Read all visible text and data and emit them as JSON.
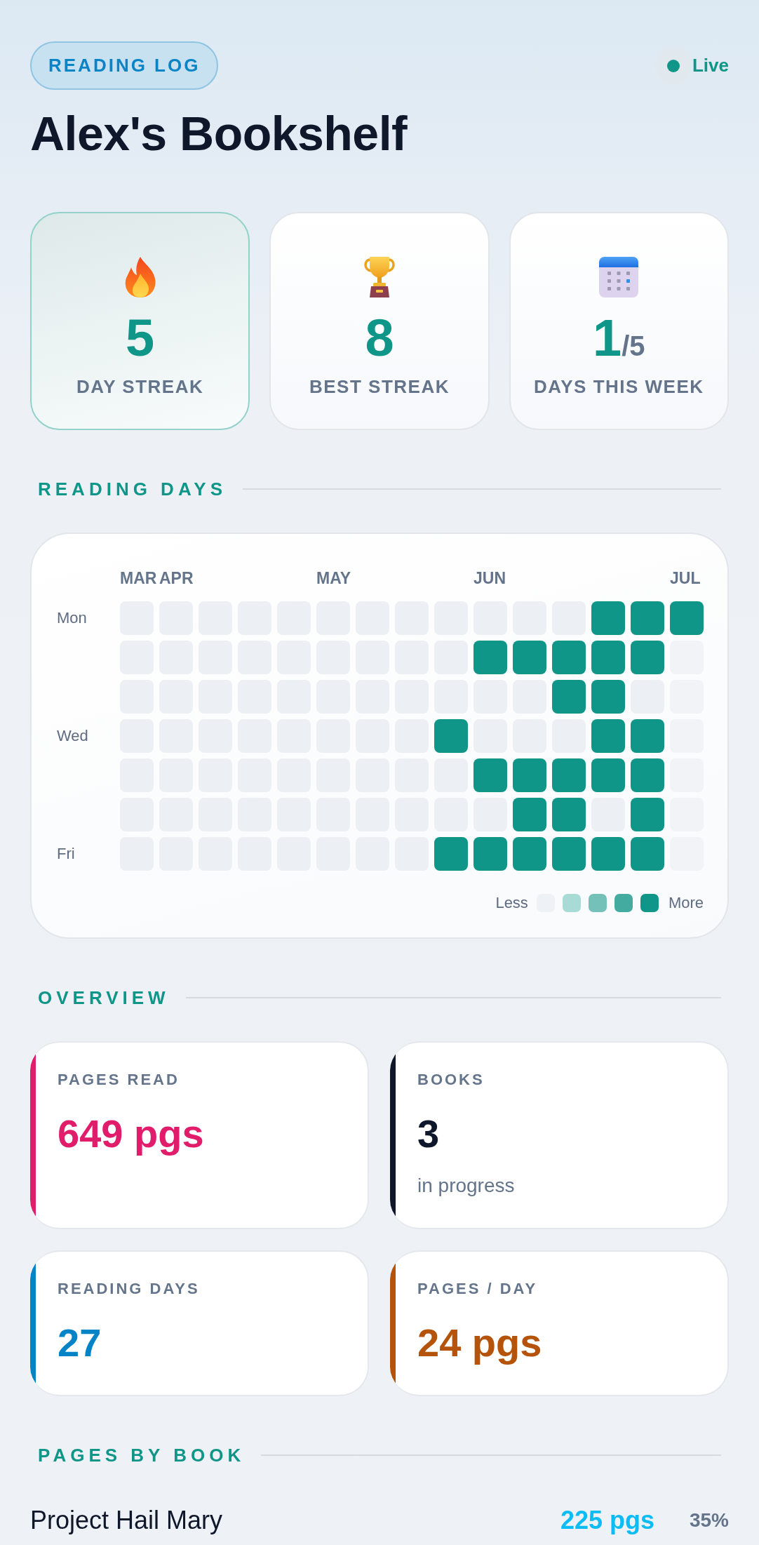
{
  "header": {
    "badge": "READING LOG",
    "status": {
      "label": "Live",
      "live": true
    },
    "title": "Alex's Bookshelf"
  },
  "stats": [
    {
      "kind": "streak",
      "value": "5",
      "label": "DAY STREAK",
      "highlighted": true
    },
    {
      "kind": "record",
      "value": "8",
      "label": "BEST STREAK",
      "highlighted": false
    },
    {
      "kind": "calendar",
      "value": "1",
      "suffix": "/5",
      "label": "DAYS THIS WEEK",
      "highlighted": false
    }
  ],
  "reading_days": {
    "heading": "READING DAYS",
    "weeks": [
      {
        "month": "MAR",
        "days": [
          {
            "kind": "empty",
            "weekday": "Mon"
          },
          {
            "kind": "empty"
          },
          {
            "kind": "empty"
          },
          {
            "kind": "empty",
            "weekday": "Wed"
          },
          {
            "kind": "empty"
          },
          {
            "kind": "empty"
          },
          {
            "kind": "empty",
            "weekday": "Fri"
          }
        ]
      },
      {
        "month": "APR",
        "days": [
          {
            "kind": "empty"
          },
          {
            "kind": "empty"
          },
          {
            "kind": "empty"
          },
          {
            "kind": "empty"
          },
          {
            "kind": "empty"
          },
          {
            "kind": "empty"
          },
          {
            "kind": "empty"
          }
        ]
      },
      {
        "days": [
          {
            "kind": "empty"
          },
          {
            "kind": "empty"
          },
          {
            "kind": "empty"
          },
          {
            "kind": "empty"
          },
          {
            "kind": "empty"
          },
          {
            "kind": "empty"
          },
          {
            "kind": "empty"
          }
        ]
      },
      {
        "days": [
          {
            "kind": "empty"
          },
          {
            "kind": "empty"
          },
          {
            "kind": "empty"
          },
          {
            "kind": "empty"
          },
          {
            "kind": "empty"
          },
          {
            "kind": "empty"
          },
          {
            "kind": "empty"
          }
        ]
      },
      {
        "days": [
          {
            "kind": "empty"
          },
          {
            "kind": "empty"
          },
          {
            "kind": "empty"
          },
          {
            "kind": "empty"
          },
          {
            "kind": "empty"
          },
          {
            "kind": "empty"
          },
          {
            "kind": "empty"
          }
        ]
      },
      {
        "month": "MAY",
        "days": [
          {
            "kind": "empty"
          },
          {
            "kind": "empty"
          },
          {
            "kind": "empty"
          },
          {
            "kind": "empty"
          },
          {
            "kind": "empty"
          },
          {
            "kind": "empty"
          },
          {
            "kind": "empty"
          }
        ]
      },
      {
        "days": [
          {
            "kind": "empty"
          },
          {
            "kind": "empty"
          },
          {
            "kind": "empty"
          },
          {
            "kind": "empty"
          },
          {
            "kind": "empty"
          },
          {
            "kind": "empty"
          },
          {
            "kind": "empty"
          }
        ]
      },
      {
        "days": [
          {
            "kind": "empty"
          },
          {
            "kind": "empty"
          },
          {
            "kind": "empty"
          },
          {
            "kind": "empty"
          },
          {
            "kind": "empty"
          },
          {
            "kind": "empty"
          },
          {
            "kind": "empty"
          }
        ]
      },
      {
        "days": [
          {
            "kind": "empty"
          },
          {
            "kind": "empty"
          },
          {
            "kind": "empty"
          },
          {
            "kind": "read"
          },
          {
            "kind": "empty"
          },
          {
            "kind": "empty"
          },
          {
            "kind": "read"
          }
        ]
      },
      {
        "month": "JUN",
        "days": [
          {
            "kind": "empty"
          },
          {
            "kind": "read"
          },
          {
            "kind": "empty"
          },
          {
            "kind": "empty"
          },
          {
            "kind": "read"
          },
          {
            "kind": "empty"
          },
          {
            "kind": "read"
          }
        ]
      },
      {
        "days": [
          {
            "kind": "empty"
          },
          {
            "kind": "read"
          },
          {
            "kind": "empty"
          },
          {
            "kind": "empty"
          },
          {
            "kind": "read"
          },
          {
            "kind": "read"
          },
          {
            "kind": "read"
          }
        ]
      },
      {
        "days": [
          {
            "kind": "empty"
          },
          {
            "kind": "read"
          },
          {
            "kind": "read"
          },
          {
            "kind": "empty"
          },
          {
            "kind": "read"
          },
          {
            "kind": "read"
          },
          {
            "kind": "read"
          }
        ]
      },
      {
        "days": [
          {
            "kind": "read"
          },
          {
            "kind": "read"
          },
          {
            "kind": "read"
          },
          {
            "kind": "read"
          },
          {
            "kind": "read"
          },
          {
            "kind": "empty"
          },
          {
            "kind": "read"
          }
        ]
      },
      {
        "days": [
          {
            "kind": "read"
          },
          {
            "kind": "read"
          },
          {
            "kind": "empty"
          },
          {
            "kind": "read"
          },
          {
            "kind": "read"
          },
          {
            "kind": "read"
          },
          {
            "kind": "read"
          }
        ]
      },
      {
        "month": "JUL",
        "days": [
          {
            "kind": "read"
          },
          {
            "kind": "future"
          },
          {
            "kind": "future"
          },
          {
            "kind": "future"
          },
          {
            "kind": "future"
          },
          {
            "kind": "future"
          },
          {
            "kind": "future"
          }
        ]
      }
    ],
    "legend": {
      "less": "Less",
      "more": "More",
      "swatches": [
        {
          "color": "#eef1f5"
        },
        {
          "color": "#a9dbd6"
        },
        {
          "color": "#73c1b9"
        },
        {
          "color": "#44aba1"
        },
        {
          "color": "#0f9688"
        }
      ]
    }
  },
  "overview": {
    "heading": "OVERVIEW",
    "cards": [
      {
        "label": "PAGES READ",
        "value": "649 pgs",
        "color": "#e11d6b"
      },
      {
        "label": "BOOKS",
        "value": "3",
        "note": "in progress",
        "color": "#0f172a"
      },
      {
        "label": "READING DAYS",
        "value": "27",
        "color": "#0284c7"
      },
      {
        "label": "PAGES / DAY",
        "value": "24 pgs",
        "color": "#b45309"
      }
    ]
  },
  "pages_by_book": {
    "heading": "PAGES BY BOOK",
    "books": [
      {
        "title": "Project Hail Mary",
        "pages": "225 pgs",
        "share": "35%",
        "color": "#0cbcf4"
      }
    ]
  }
}
